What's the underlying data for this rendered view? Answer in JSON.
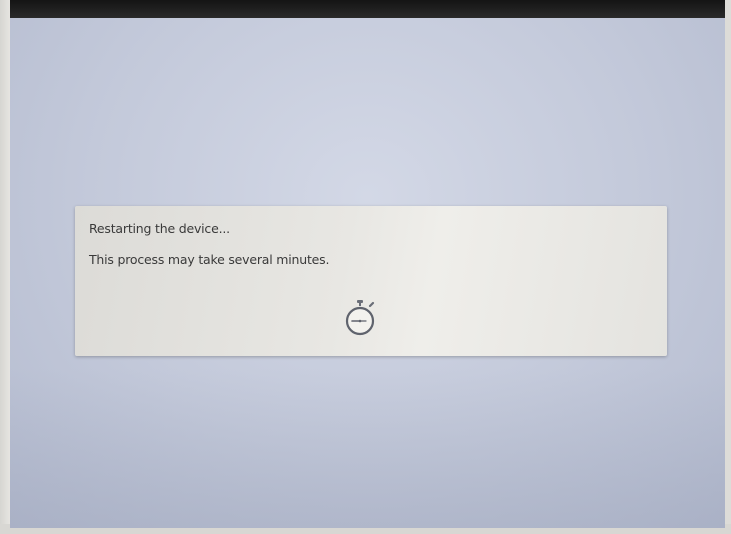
{
  "dialog": {
    "title": "Restarting the device...",
    "message": "This process may take several minutes."
  },
  "icons": {
    "busy": "stopwatch-icon"
  }
}
